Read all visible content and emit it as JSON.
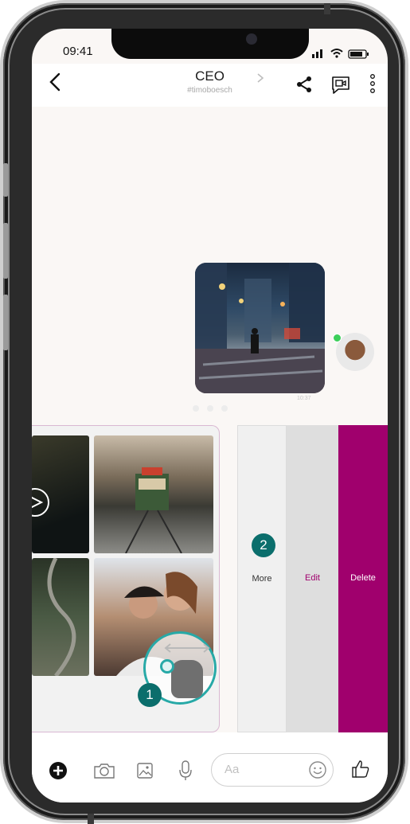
{
  "status": {
    "time": "09:41"
  },
  "header": {
    "title": "CEO",
    "subtitle": "#timoboesch"
  },
  "message": {
    "timestamp": "10:37"
  },
  "hints": {
    "step1": "1",
    "step2": "2"
  },
  "actions": {
    "more": "More",
    "edit": "Edit",
    "delete": "Delete"
  },
  "composer": {
    "placeholder": "Aa"
  },
  "colors": {
    "accent": "#a0006d",
    "hint": "#0b6e6c",
    "online": "#3ccf5a"
  },
  "icons": [
    "back-arrow-icon",
    "chevron-right-icon",
    "share-icon",
    "video-message-icon",
    "kebab-menu-icon",
    "plus-icon",
    "camera-icon",
    "image-icon",
    "microphone-icon",
    "emoji-icon",
    "thumbs-up-icon",
    "swipe-gesture-icon"
  ]
}
